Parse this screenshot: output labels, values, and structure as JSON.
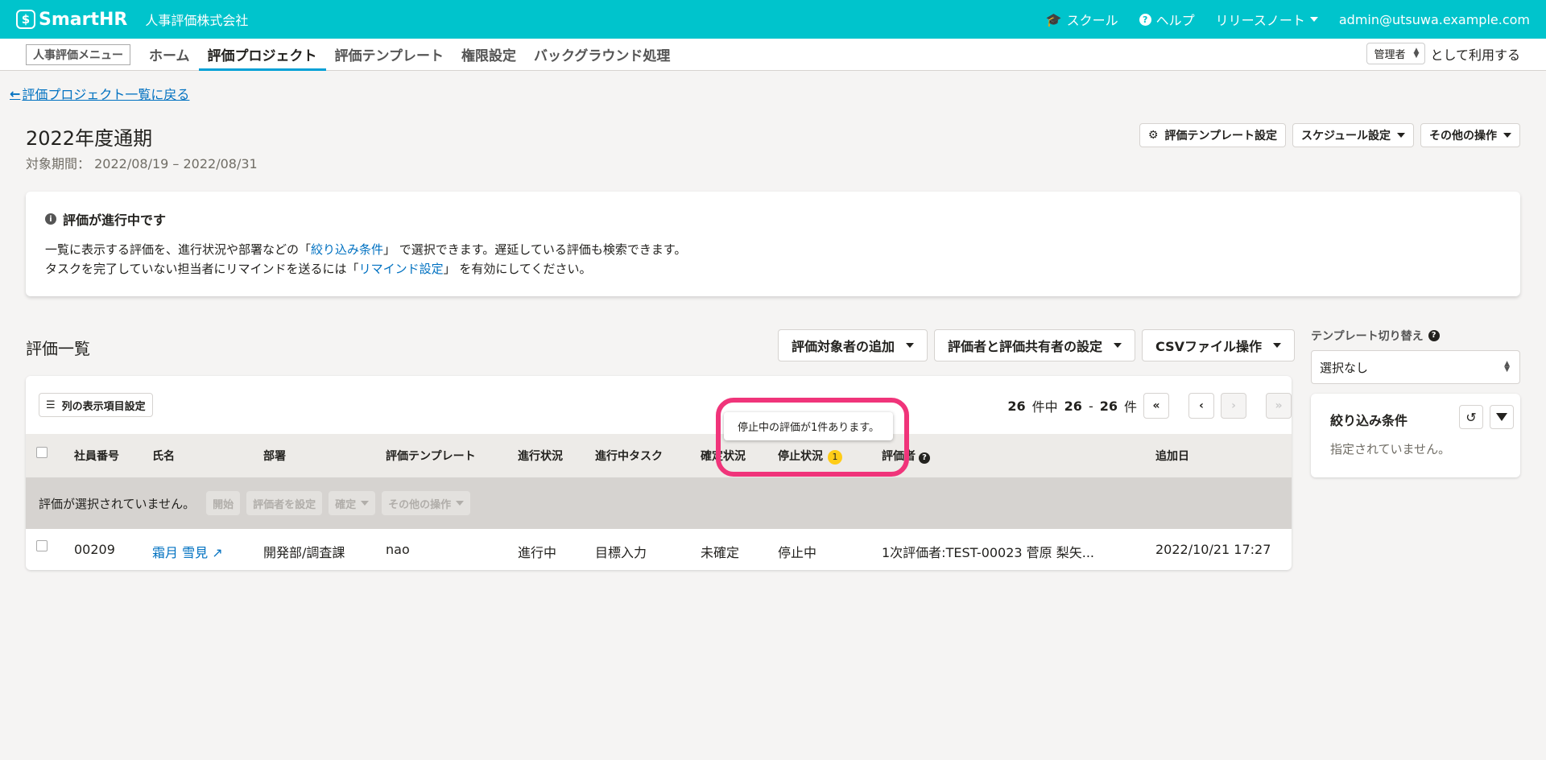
{
  "header": {
    "logo": "SmartHR",
    "company": "人事評価株式会社",
    "nav": [
      "スクール",
      "ヘルプ",
      "リリースノート",
      "admin@utsuwa.example.com"
    ]
  },
  "subnav": {
    "menu_tag": "人事評価メニュー",
    "tabs": [
      "ホーム",
      "評価プロジェクト",
      "評価テンプレート",
      "権限設定",
      "バックグラウンド処理"
    ],
    "role": "管理者",
    "role_suffix": "として利用する"
  },
  "back_link": "評価プロジェクト一覧に戻る",
  "project": {
    "title": "2022年度通期",
    "period_label": "対象期間：",
    "period": "2022/08/19 – 2022/08/31"
  },
  "header_buttons": [
    "評価テンプレート設定",
    "スケジュール設定",
    "その他の操作"
  ],
  "info": {
    "title": "評価が進行中です",
    "line1_pre": "一覧に表示する評価を、進行状況や部署などの「",
    "line1_link": "絞り込み条件",
    "line1_post": "」 で選択できます。遅延している評価も検索できます。",
    "line2_pre": "タスクを完了していない担当者にリマインドを送るには「",
    "line2_link": "リマインド設定",
    "line2_post": "」 を有効にしてください。"
  },
  "list": {
    "title": "評価一覧",
    "buttons": [
      "評価対象者の追加",
      "評価者と評価共有者の設定",
      "CSVファイル操作"
    ],
    "columns_button": "列の表示項目設定",
    "pager": {
      "total": "26",
      "of": "件中",
      "from": "26",
      "dash": "-",
      "to": "26",
      "unit": "件"
    },
    "columns": [
      "社員番号",
      "氏名",
      "部署",
      "評価テンプレート",
      "進行状況",
      "進行中タスク",
      "確定状況",
      "停止状況",
      "評価者",
      "追加日"
    ],
    "stopped_badge": "1",
    "selection_text": "評価が選択されていません。",
    "selection_buttons": [
      "開始",
      "評価者を設定",
      "確定",
      "その他の操作"
    ],
    "rows": [
      {
        "id": "00209",
        "name": "霜月 雪見",
        "dept": "開発部/調査課",
        "template": "nao",
        "progress": "進行中",
        "task": "目標入力",
        "confirm": "未確定",
        "stopped": "停止中",
        "evaluator": "1次評価者:TEST-00023 菅原 梨矢...",
        "added": "2022/10/21 17:27"
      }
    ],
    "tooltip": "停止中の評価が1件あります。"
  },
  "side": {
    "template_label": "テンプレート切り替え",
    "template_value": "選択なし",
    "filter_title": "絞り込み条件",
    "filter_empty": "指定されていません。"
  }
}
